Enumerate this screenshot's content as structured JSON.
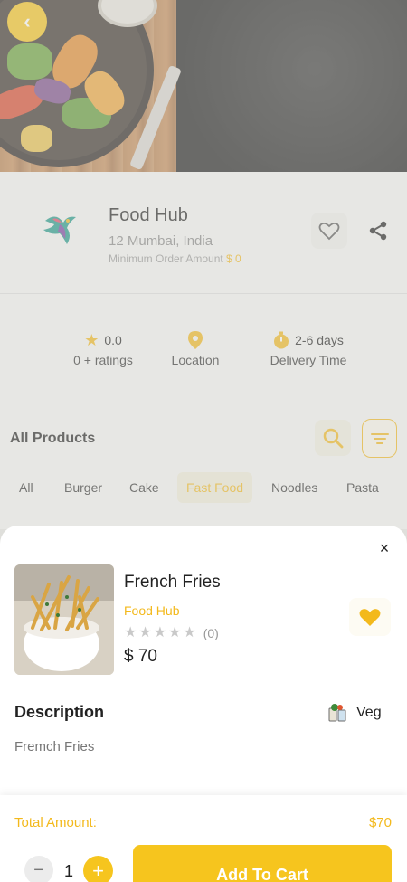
{
  "store": {
    "name": "Food Hub",
    "address": "12 Mumbai, India",
    "min_order_label": "Minimum Order Amount",
    "min_order_value": "$ 0"
  },
  "stats": {
    "rating_value": "0.0",
    "rating_label": "0 + ratings",
    "location_label": "Location",
    "delivery_value": "2-6 days",
    "delivery_label": "Delivery Time"
  },
  "products": {
    "title": "All Products",
    "categories": [
      {
        "label": "All"
      },
      {
        "label": "Burger"
      },
      {
        "label": "Cake"
      },
      {
        "label": "Fast Food",
        "active": true
      },
      {
        "label": "Noodles"
      },
      {
        "label": "Pasta"
      }
    ]
  },
  "sheet": {
    "close": "×",
    "product": {
      "name": "French Fries",
      "store": "Food Hub",
      "rating_count": "(0)",
      "rating": 0,
      "price": "$ 70",
      "favorited": true
    },
    "description": {
      "title": "Description",
      "type": "Veg",
      "text": "Fremch Fries"
    },
    "footer": {
      "total_label": "Total Amount:",
      "total_value": "$70",
      "quantity": "1",
      "minus": "−",
      "plus": "+",
      "add_to_cart": "Add To Cart"
    }
  },
  "colors": {
    "accent": "#f6c51e",
    "accent_text": "#f3b91c"
  }
}
